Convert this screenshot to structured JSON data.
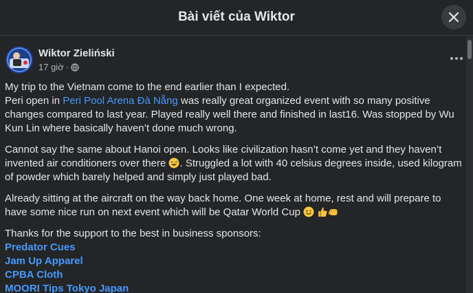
{
  "header": {
    "title": "Bài viết của Wiktor"
  },
  "post": {
    "author": "Wiktor Zieliński",
    "time": "17 giờ",
    "separator": "·",
    "p1_line1": "My trip to the Vietnam come to the end earlier than I expected.",
    "p1_prefix": "Peri open in ",
    "p1_link": "Peri Pool Arena Đà Nẵng",
    "p1_suffix": " was really great organized event with so many positive changes compared to last year. Played really well there and finished in last16. Was stopped by Wu Kun Lin where basically haven’t done much wrong.",
    "p2_part1": "Cannot say the same about Hanoi open. Looks like civilization hasn’t come yet and they haven’t invented air conditioners over there ",
    "p2_part2": ". Struggled a lot with 40 celsius degrees inside, used kilogram of powder which barely helped and simply just played bad.",
    "p3_text": "Already sitting at the aircraft on the way back home. One week at home, rest and will prepare to have some nice run on next event which will be Qatar World Cup ",
    "p4_intro": "Thanks for the support to the best in business sponsors:",
    "sponsors": [
      "Predator Cues",
      "Jam Up Apparel",
      "CPBA Cloth",
      "MOORI Tips Tokyo Japan"
    ]
  },
  "icons": {
    "close": "close-icon",
    "globe": "globe-icon",
    "more": "more-dots-icon",
    "emoji_sweat": "sweat-smile-emoji-icon",
    "emoji_smile": "smile-emoji-icon",
    "emoji_thumbs": "thumbs-up-emoji-icon",
    "emoji_fist": "fist-emoji-icon"
  },
  "colors": {
    "background": "#242526",
    "text": "#e4e6eb",
    "secondary": "#b0b3b8",
    "link": "#4599ff",
    "button": "#3a3b3c"
  }
}
